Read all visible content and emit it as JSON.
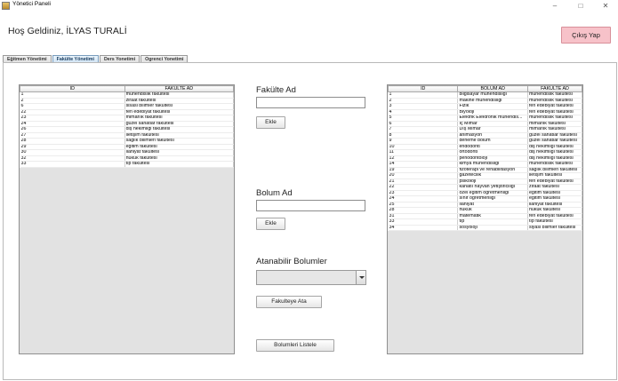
{
  "window": {
    "title": "Yönetici Paneli",
    "controls": {
      "minimize": "–",
      "maximize": "□",
      "close": "✕"
    }
  },
  "header": {
    "welcome": "Hoş Geldiniz, İLYAS TURALİ",
    "logout_label": "Çıkış Yap"
  },
  "tabs": [
    {
      "label": "Eğitmen Yönetimi"
    },
    {
      "label": "Fakülte Yönetimi"
    },
    {
      "label": "Ders Yonetimi"
    },
    {
      "label": "Ogrenci Yonetimi"
    }
  ],
  "faculty_table": {
    "columns": [
      "ID",
      "FAKULTE AD"
    ],
    "rows": [
      [
        "1",
        "mühendislik fakültesi"
      ],
      [
        "2",
        "ziraat fakültesi"
      ],
      [
        "6",
        "sisasi bilimler fakültesi"
      ],
      [
        "22",
        "fen edebiyat fakültesi"
      ],
      [
        "23",
        "mimarlık fakültesi"
      ],
      [
        "24",
        "güzel sanatlar fakültesi"
      ],
      [
        "26",
        "diş hekimliği fakültesi"
      ],
      [
        "27",
        "iletişim fakültesi"
      ],
      [
        "28",
        "sağlık bilimleri fakültesi"
      ],
      [
        "29",
        "eğitim fakültesi"
      ],
      [
        "30",
        "ilahiyat fakültesi"
      ],
      [
        "32",
        "hukuk fakültesi"
      ],
      [
        "33",
        "tıp fakültesi"
      ]
    ]
  },
  "faculty_form": {
    "title": "Fakülte Ad",
    "input_value": "",
    "add_label": "Ekle"
  },
  "department_form": {
    "title": "Bolum Ad",
    "input_value": "",
    "add_label": "Ekle"
  },
  "assign": {
    "title": "Atanabilir Bolumler",
    "selected": "",
    "assign_label": "Fakulteye Ata",
    "list_label": "Bolumleri Listele"
  },
  "department_table": {
    "columns": [
      "ID",
      "BOLUM AD",
      "FAKULTE AD"
    ],
    "rows": [
      [
        "1",
        "bilgisayar mühendisliği",
        "mühendislik fakültesi"
      ],
      [
        "2",
        "makine mühendisliği",
        "mühendislik fakültesi"
      ],
      [
        "3",
        "Fizik",
        "fen edebiyat fakültesi"
      ],
      [
        "4",
        "Biyoloji",
        "fen edebiyat fakültesi"
      ],
      [
        "5",
        "Elektrik Elektronik mühendis...",
        "mühendislik fakültesi"
      ],
      [
        "6",
        "İç Mimar",
        "mimarlık fakültesi"
      ],
      [
        "7",
        "Dış Mimar",
        "mimarlık fakültesi"
      ],
      [
        "8",
        "animasyon",
        "güzel sanatlar fakültesi"
      ],
      [
        "9",
        "deneme bölüm",
        "güzel sanatlar fakültesi"
      ],
      [
        "10",
        "endodonti",
        "diş hekimliği fakültesi"
      ],
      [
        "11",
        "ortodonti",
        "diş hekimliği fakültesi"
      ],
      [
        "12",
        "periodontoloji",
        "diş hekimliği fakültesi"
      ],
      [
        "14",
        "kimya mühendisliği",
        "mühendislik fakültesi"
      ],
      [
        "19",
        "fizoterapi ve rehabilitasyon",
        "sağlık bilimleri fakültesi"
      ],
      [
        "20",
        "gazetecilik",
        "iletişim fakültesi"
      ],
      [
        "21",
        "psikoloji",
        "fen edebiyat fakültesi"
      ],
      [
        "22",
        "kanatlı hayvan yetiştiriciliği",
        "ziraat fakültesi"
      ],
      [
        "23",
        "özel eğitim öğretmenliği",
        "eğitim fakültesi"
      ],
      [
        "24",
        "sınıf öğretmenliği",
        "eğitim fakültesi"
      ],
      [
        "25",
        "ilahiyat",
        "ilahiyat fakültesi"
      ],
      [
        "28",
        "hukuk",
        "hukuk fakültesi"
      ],
      [
        "31",
        "matematik",
        "fen edebiyat fakültesi"
      ],
      [
        "33",
        "tıp",
        "tıp fakültesi"
      ],
      [
        "34",
        "sosyoloji",
        "siyasi bilimler fakültesi"
      ]
    ]
  }
}
